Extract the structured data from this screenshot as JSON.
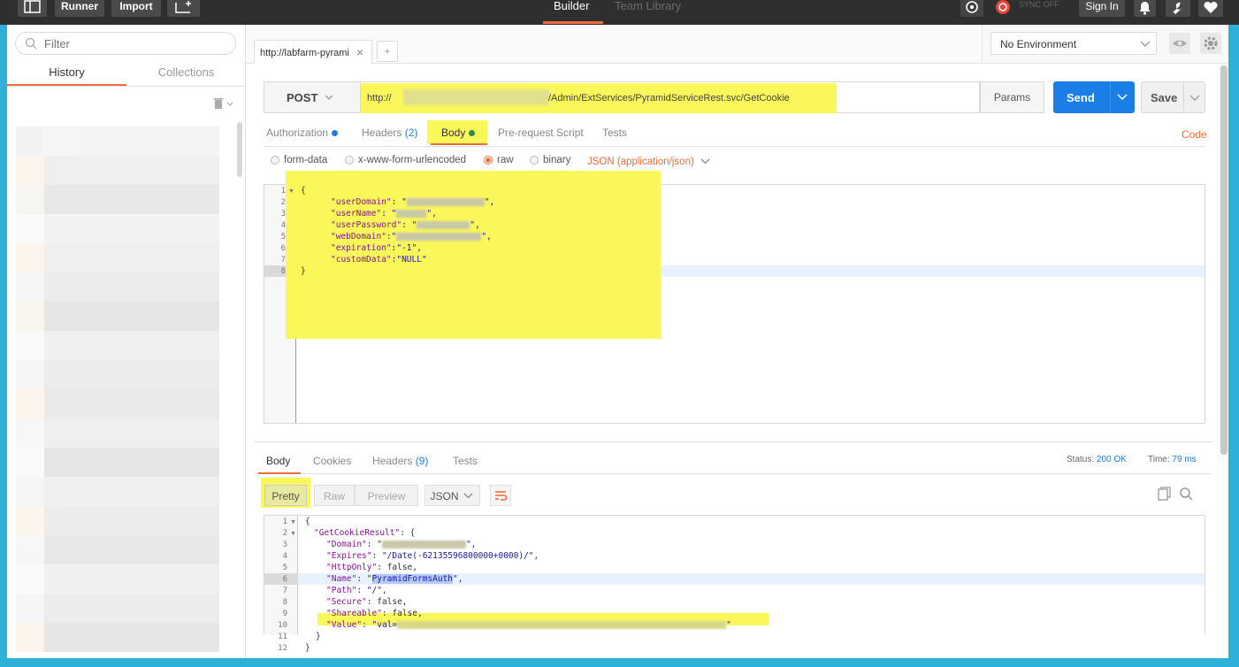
{
  "topbar": {
    "runner": "Runner",
    "import": "Import",
    "tabs": [
      "Builder",
      "Team Library"
    ],
    "sync": "SYNC OFF",
    "signin": "Sign In"
  },
  "sidebar": {
    "filter_placeholder": "Filter",
    "tabs": [
      "History",
      "Collections"
    ]
  },
  "request_tab": {
    "label": "http://labfarm-pyrami",
    "close": "×",
    "plus": "+"
  },
  "environment": {
    "selected": "No Environment"
  },
  "request": {
    "method": "POST",
    "url_prefix": "http://",
    "url_suffix": "/Admin/ExtServices/PyramidServiceRest.svc/GetCookie",
    "params": "Params",
    "send": "Send",
    "save": "Save"
  },
  "req_tabs": {
    "authorization": "Authorization",
    "headers": "Headers",
    "headers_count": "(2)",
    "body": "Body",
    "prerequest": "Pre-request Script",
    "tests": "Tests",
    "code": "Code"
  },
  "body_opts": {
    "form_data": "form-data",
    "urlencoded": "x-www-form-urlencoded",
    "raw": "raw",
    "binary": "binary",
    "json_type": "JSON (application/json)"
  },
  "request_body": {
    "lines": [
      {
        "n": "1",
        "text": "{"
      },
      {
        "n": "2",
        "key": "\"userDomain\"",
        "rest": ": \"",
        "end": "\","
      },
      {
        "n": "3",
        "key": "\"userName\"",
        "rest": ": \"",
        "end": "\","
      },
      {
        "n": "4",
        "key": "\"userPassword\"",
        "rest": ": \"",
        "end": "\","
      },
      {
        "n": "5",
        "key": "\"webDomain\"",
        "rest": ":\"",
        "end": "\","
      },
      {
        "n": "6",
        "key": "\"expiration\"",
        "rest": ":\"-1\","
      },
      {
        "n": "7",
        "key": "\"customData\"",
        "rest": ":\"NULL\""
      },
      {
        "n": "8",
        "text": "}"
      }
    ]
  },
  "response": {
    "tabs": {
      "body": "Body",
      "cookies": "Cookies",
      "headers": "Headers",
      "headers_count": "(9)",
      "tests": "Tests"
    },
    "status_label": "Status:",
    "status_value": "200 OK",
    "time_label": "Time:",
    "time_value": "79 ms",
    "views": [
      "Pretty",
      "Raw",
      "Preview"
    ],
    "format": "JSON",
    "lines": [
      {
        "n": "1",
        "text": "{"
      },
      {
        "n": "2",
        "key": "\"GetCookieResult\"",
        "rest": ": {"
      },
      {
        "n": "3",
        "key": "\"Domain\"",
        "rest": ": \"",
        "end": "\","
      },
      {
        "n": "4",
        "key": "\"Expires\"",
        "rest": ": ",
        "str": "\"/Date(-62135596800000+0000)/\"",
        "end": ","
      },
      {
        "n": "5",
        "key": "\"HttpOnly\"",
        "rest": ": false,"
      },
      {
        "n": "6",
        "key": "\"Name\"",
        "rest": ": \"",
        "sel": "PyramidFormsAuth",
        "end": "\","
      },
      {
        "n": "7",
        "key": "\"Path\"",
        "rest": ": ",
        "str": "\"/\"",
        "end": ","
      },
      {
        "n": "8",
        "key": "\"Secure\"",
        "rest": ": false,"
      },
      {
        "n": "9",
        "key": "\"Shareable\"",
        "rest": ": false,"
      },
      {
        "n": "10",
        "key": "\"Value\"",
        "rest": ": ",
        "str": "\"val=",
        "end": "\""
      },
      {
        "n": "11",
        "text": "}"
      },
      {
        "n": "12",
        "text": "}"
      }
    ]
  },
  "colors": {
    "accent": "#f26b3a",
    "send": "#1a7ee6",
    "highlight": "#f9f75a"
  }
}
